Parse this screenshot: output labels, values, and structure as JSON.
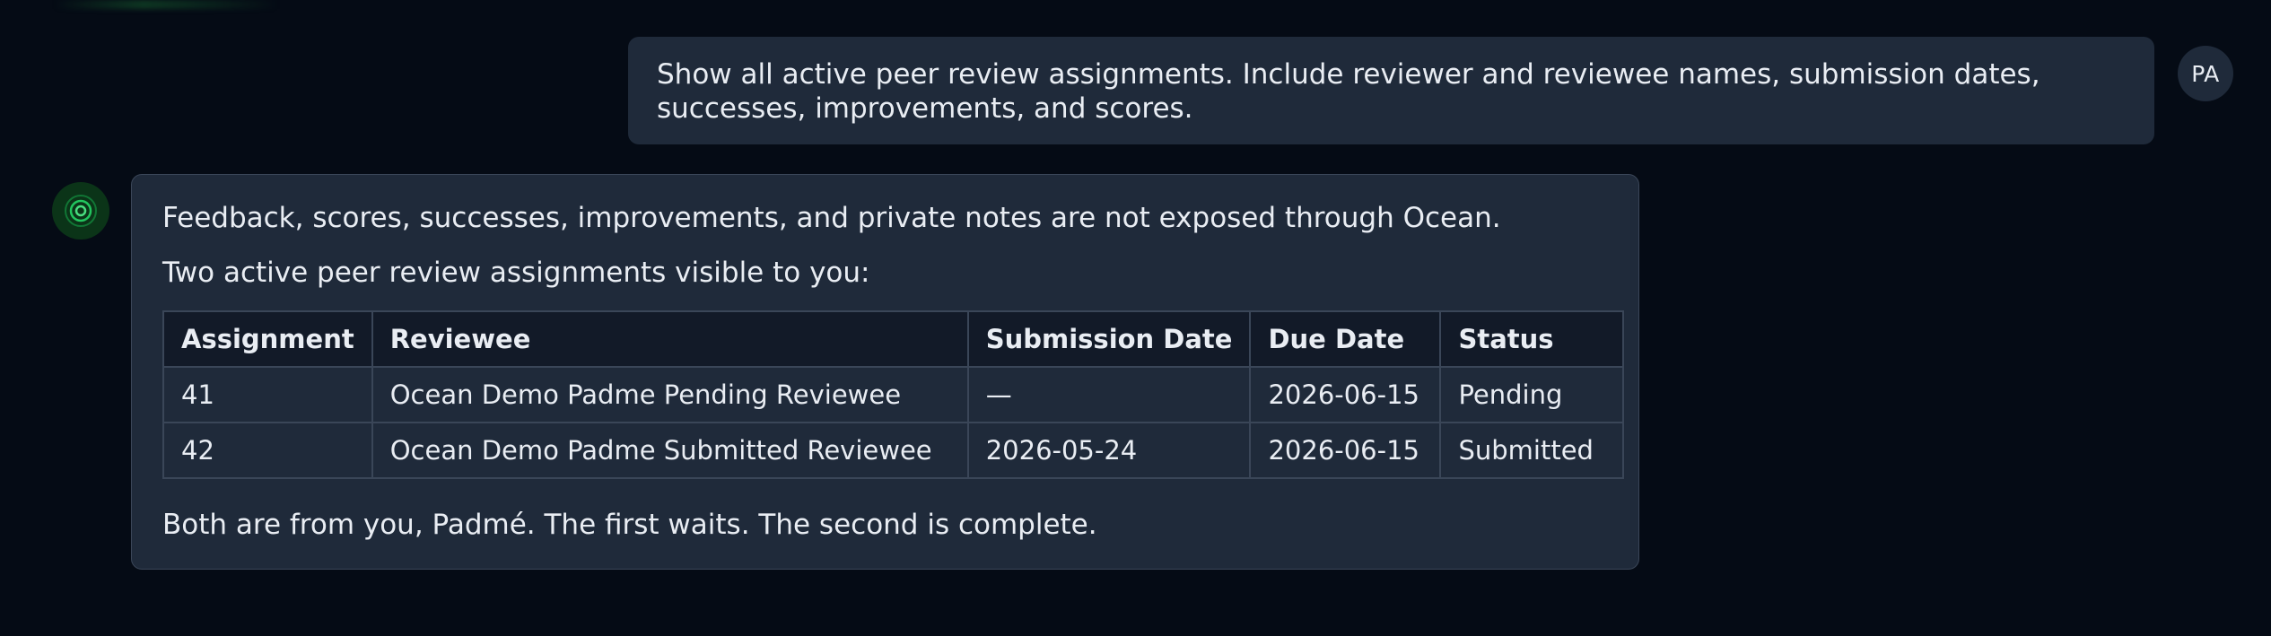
{
  "user_message": {
    "text": "Show all active peer review assignments. Include reviewer and reviewee names, submission dates, successes, improvements, and scores.",
    "avatar_initials": "PA"
  },
  "assistant_message": {
    "line1": "Feedback, scores, successes, improvements, and private notes are not exposed through Ocean.",
    "line2": "Two active peer review assignments visible to you:",
    "footer": "Both are from you, Padmé. The first waits. The second is complete.",
    "table": {
      "headers": [
        "Assignment",
        "Reviewee",
        "Submission Date",
        "Due Date",
        "Status"
      ],
      "rows": [
        [
          "41",
          "Ocean Demo Padme Pending Reviewee",
          "—",
          "2026-06-15",
          "Pending"
        ],
        [
          "42",
          "Ocean Demo Padme Submitted Reviewee",
          "2026-05-24",
          "2026-06-15",
          "Submitted"
        ]
      ]
    }
  },
  "colors": {
    "background": "#050b15",
    "bubble": "#1f2a3a",
    "table_header": "#121a28",
    "accent_green": "#22c55e",
    "text": "#e9edf3"
  },
  "icons": {
    "assistant_avatar": "concentric-rings-icon"
  }
}
